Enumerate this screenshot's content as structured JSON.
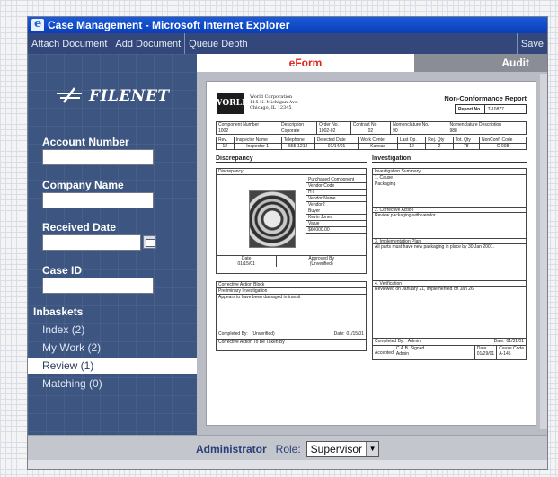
{
  "window": {
    "title": "Case Management - Microsoft Internet Explorer"
  },
  "toolbar": {
    "attach": "Attach Document",
    "add": "Add Document",
    "queue": "Queue Depth",
    "save": "Save"
  },
  "sidebar": {
    "logo": "FILENET",
    "account_label": "Account Number",
    "company_label": "Company Name",
    "received_label": "Received Date",
    "caseid_label": "Case ID",
    "inbaskets_label": "Inbaskets",
    "inbaskets": [
      {
        "label": "Index (2)"
      },
      {
        "label": "My Work (2)"
      },
      {
        "label": "Review (1)"
      },
      {
        "label": "Matching (0)"
      }
    ],
    "selected_inbasket": "Review (1)"
  },
  "tabs": {
    "eform": "eForm",
    "audit": "Audit"
  },
  "form": {
    "logo": "WORLD",
    "company": "World Corporation",
    "addr1": "115 N. Michigan Ave.",
    "addr2": "Chicago, IL 12345",
    "title": "Non-Conformance Report",
    "report_no_label": "Report No.",
    "report_no": "T-10877",
    "row1_headers": [
      "Component Number",
      "Description",
      "Order No.",
      "Contract No",
      "Nomenclature No.",
      "Nomenclature Description"
    ],
    "row1_values": [
      "1002",
      "Coporate",
      "1002-02",
      "02",
      "90",
      "988"
    ],
    "row2_headers": [
      "Rev.",
      "Inspector Name",
      "Telephone",
      "Detected Date",
      "Work Center",
      "Last Op.",
      "Rej. Qty",
      "Tot. Qty",
      "NonConf. Code"
    ],
    "row2_values": [
      "12",
      "Inspector 1",
      "555-1212",
      "01/14/01",
      "Kansas",
      "12",
      "2",
      "78",
      "C-008"
    ],
    "discrepancy_h": "Discrepancy",
    "investigation_h": "Investigation",
    "disc_box_title": "Discrepancy",
    "purchased": "Purchased Component",
    "vendor_code_l": "Vendor Code",
    "vendor_code": "HT",
    "vendor_name_l": "Vendor Name",
    "vendor_name": "Vendor2",
    "buyer_l": "Buyer",
    "buyer": "Kevin Jones",
    "value_l": "Value",
    "value": "$60000.00",
    "date_l": "Date",
    "date": "01/15/01",
    "approved_l": "Approved By",
    "approved": "(Unverified)",
    "cab_title": "Corrective Action Block",
    "prelim_l": "Preliminary Investigation",
    "prelim": "Appears to have been damaged in transit",
    "completed_l": "Completed By:",
    "completed": "(Unverified)",
    "cdate_l": "Date:",
    "cdate": "01/15/01",
    "cat_l": "Corrective Action To Be Taken By",
    "inv_summary": "Investigation Summary",
    "cause_l": "1. Cause",
    "cause": "Packaging",
    "corrective_l": "2. Corrective Action",
    "corrective": "Review packaging with vendor.",
    "impl_l": "3. Implementation Plan",
    "impl": "All parts must have new packaging in place by 30 Jan 2001.",
    "verif_l": "4. Verification",
    "verif": "Reviewed on January 21, implemented on Jan 26",
    "icomp_l": "Completed By:",
    "icomp": "Admin",
    "idate_l": "Date:",
    "idate": "01/31/01",
    "cab_signed_l": "C.A.B. Signed",
    "accepted_l": "Accepted",
    "signed_by": "Admin",
    "sdate_l": "Date",
    "sdate": "01/29/01",
    "cause_code_l": "Cause Code",
    "cause_code": "A-145"
  },
  "footer": {
    "user": "Administrator",
    "role_label": "Role:",
    "role_value": "Supervisor"
  }
}
